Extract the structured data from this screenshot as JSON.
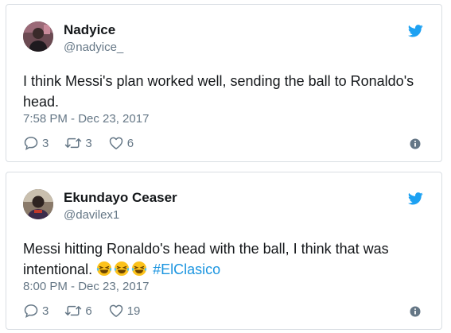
{
  "tweets": [
    {
      "name": "Nadyice",
      "handle": "@nadyice_",
      "text": "I think Messi's plan worked well, sending the ball to Ronaldo's head.",
      "time": "7:58 PM - Dec 23, 2017",
      "replies": "3",
      "retweets": "3",
      "likes": "6"
    },
    {
      "name": "Ekundayo Ceaser",
      "handle": "@davilex1",
      "text": "Messi hitting Ronaldo's head with the ball, I think that was intentional.",
      "emojis": [
        "😂",
        "😂",
        "😂"
      ],
      "hashtag": "#ElClasico",
      "time": "8:00 PM - Dec 23, 2017",
      "replies": "3",
      "retweets": "6",
      "likes": "19"
    }
  ],
  "icons": {
    "brand": "twitter-bird-icon",
    "reply": "reply-icon",
    "retweet": "retweet-icon",
    "like": "heart-icon",
    "info": "info-icon"
  },
  "colors": {
    "twitter_blue": "#1da1f2",
    "hashtag": "#1b95e0",
    "secondary_text": "#657786",
    "primary_text": "#14171a",
    "card_border": "#d9dee3"
  }
}
